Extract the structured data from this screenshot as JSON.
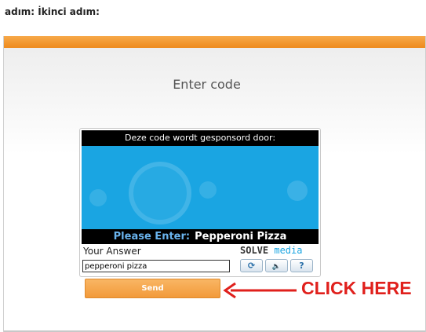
{
  "header": {
    "caption": "adım: İkinci adım:"
  },
  "panel": {
    "title": "Enter code"
  },
  "captcha": {
    "sponsor_text": "Deze code wordt gesponsord door:",
    "prompt_label": "Please Enter:",
    "prompt_value": "Pepperoni Pizza",
    "answer_label": "Your Answer",
    "answer_value": "pepperoni pizza",
    "brand_solve": "SOLVE",
    "brand_media": "media",
    "tools": {
      "refresh_glyph": "⟳",
      "audio_glyph": "🔈",
      "help_glyph": "?"
    }
  },
  "send_button": {
    "label": "Send"
  },
  "annotation": {
    "text": "CLICK HERE",
    "color": "#e0201c"
  },
  "colors": {
    "accent_orange": "#ee8a1c",
    "ad_blue": "#1aa5e2"
  }
}
